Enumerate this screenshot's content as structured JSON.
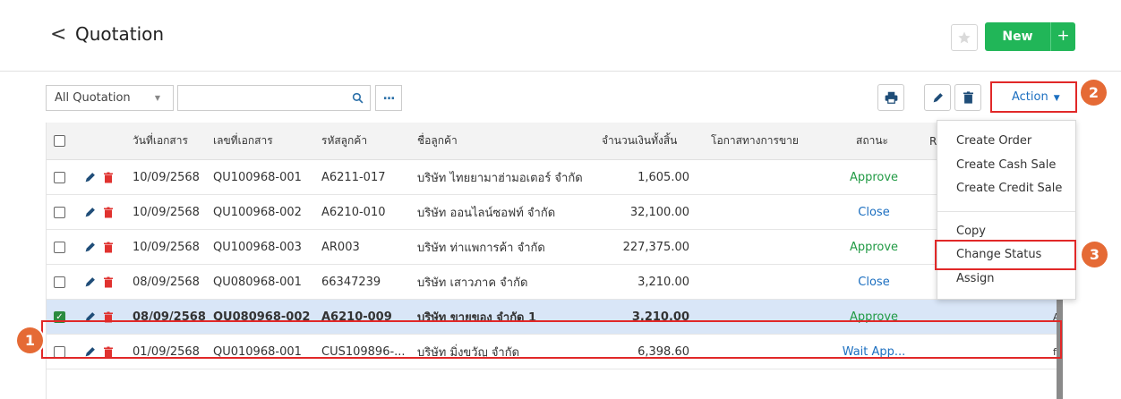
{
  "header": {
    "back_glyph": "<",
    "title": "Quotation",
    "new_label": "New",
    "new_plus": "+"
  },
  "toolbar": {
    "filter_value": "All Quotation",
    "search_placeholder": "",
    "more_label": "...",
    "action_label": "Action"
  },
  "badges": {
    "one": "1",
    "two": "2",
    "three": "3"
  },
  "columns": [
    "วันที่เอกสาร",
    "เลขที่เอกสาร",
    "รหัสลูกค้า",
    "ชื่อลูกค้า",
    "จำนวนเงินทั้งสิ้น",
    "โอกาสทางการขาย",
    "สถานะ",
    "Re"
  ],
  "rows": [
    {
      "date": "10/09/2568",
      "doc_no": "QU100968-001",
      "cust_code": "A6211-017",
      "cust_name": "บริษัท ไทยยามาฮ่ามอเตอร์ จำกัด",
      "amount": "1,605.00",
      "status": "Approve",
      "clip": ""
    },
    {
      "date": "10/09/2568",
      "doc_no": "QU100968-002",
      "cust_code": "A6210-010",
      "cust_name": "บริษัท ออนไลน์ซอฟท์ จำกัด",
      "amount": "32,100.00",
      "status": "Close",
      "clip": ""
    },
    {
      "date": "10/09/2568",
      "doc_no": "QU100968-003",
      "cust_code": "AR003",
      "cust_name": "บริษัท ท่าแพการค้า จำกัด",
      "amount": "227,375.00",
      "status": "Approve",
      "clip": ""
    },
    {
      "date": "08/09/2568",
      "doc_no": "QU080968-001",
      "cust_code": "66347239",
      "cust_name": "บริษัท เสาวภาค จำกัด",
      "amount": "3,210.00",
      "status": "Close",
      "clip": "ะ"
    },
    {
      "date": "08/09/2568",
      "doc_no": "QU080968-002",
      "cust_code": "A6210-009",
      "cust_name": "บริษัท ขายของ จำกัด 1",
      "amount": "3,210.00",
      "status": "Approve",
      "clip": "A"
    },
    {
      "date": "01/09/2568",
      "doc_no": "QU010968-001",
      "cust_code": "CUS109896-...",
      "cust_name": "บริษัท มิ่งขวัญ จำกัด",
      "amount": "6,398.60",
      "status": "Wait App...",
      "clip": "f"
    }
  ],
  "menu": {
    "items": [
      "Create Order",
      "Create Cash Sale",
      "Create Credit Sale",
      "Copy",
      "Change Status",
      "Assign"
    ]
  },
  "colors": {
    "accent_green": "#21b658",
    "status_green": "#219a44",
    "link_blue": "#1c6fc0",
    "highlight_red": "#e12828",
    "badge_orange": "#e56a35",
    "selected_row": "#d9e6f7"
  }
}
